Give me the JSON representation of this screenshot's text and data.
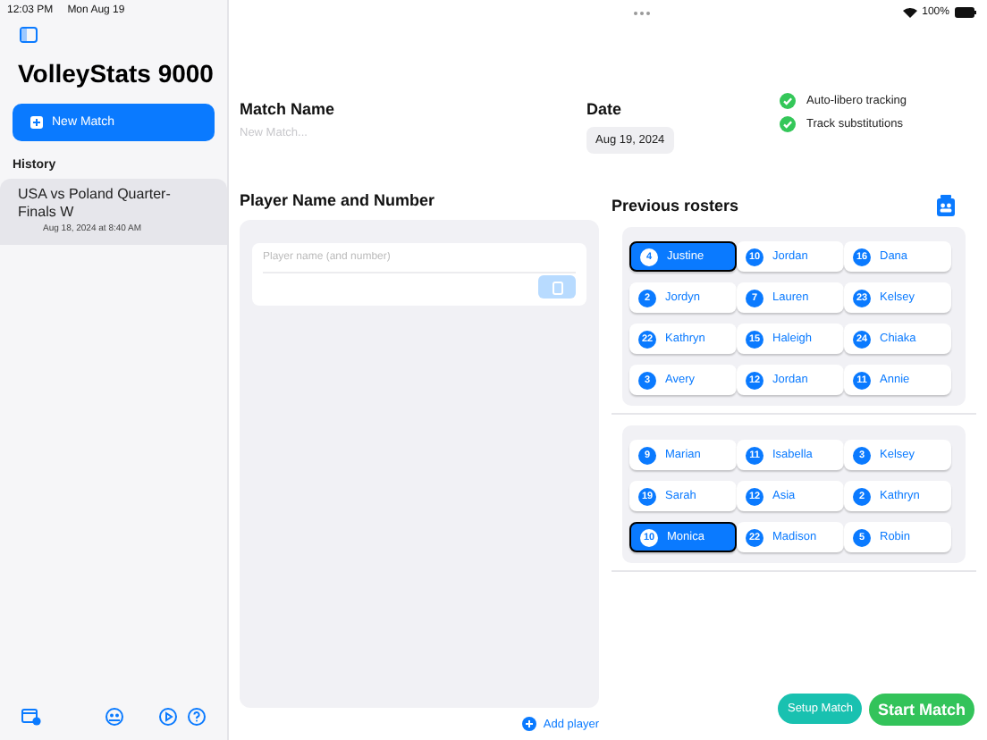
{
  "status_bar": {
    "time": "12:03 PM",
    "date": "Mon Aug 19",
    "battery": "100%"
  },
  "sidebar": {
    "title": "VolleyStats 9000",
    "new_match_button": "New Match",
    "history_label": "History",
    "history": [
      {
        "title": "USA vs Poland Quarter-Finals W",
        "subtitle": "Aug 18, 2024 at 8:40 AM",
        "selected": true
      }
    ]
  },
  "match_name": {
    "label": "Match Name",
    "placeholder": "New Match..."
  },
  "date": {
    "label": "Date",
    "value": "Aug 19, 2024"
  },
  "options": [
    {
      "label": "Auto-libero tracking",
      "checked": true
    },
    {
      "label": "Track substitutions",
      "checked": true
    }
  ],
  "player_entry": {
    "label": "Player Name and Number",
    "placeholder": "Player name (and number)",
    "add_player": "Add player"
  },
  "previous_rosters": {
    "label": "Previous rosters",
    "rosters": [
      {
        "players": [
          {
            "number": "4",
            "name": "Justine",
            "selected": true
          },
          {
            "number": "10",
            "name": "Jordan",
            "selected": false
          },
          {
            "number": "16",
            "name": "Dana",
            "selected": false
          },
          {
            "number": "2",
            "name": "Jordyn",
            "selected": false
          },
          {
            "number": "7",
            "name": "Lauren",
            "selected": false
          },
          {
            "number": "23",
            "name": "Kelsey",
            "selected": false
          },
          {
            "number": "22",
            "name": "Kathryn",
            "selected": false
          },
          {
            "number": "15",
            "name": "Haleigh",
            "selected": false
          },
          {
            "number": "24",
            "name": "Chiaka",
            "selected": false
          },
          {
            "number": "3",
            "name": "Avery",
            "selected": false
          },
          {
            "number": "12",
            "name": "Jordan",
            "selected": false
          },
          {
            "number": "11",
            "name": "Annie",
            "selected": false
          }
        ]
      },
      {
        "players": [
          {
            "number": "9",
            "name": "Marian",
            "selected": false
          },
          {
            "number": "11",
            "name": "Isabella",
            "selected": false
          },
          {
            "number": "3",
            "name": "Kelsey",
            "selected": false
          },
          {
            "number": "19",
            "name": "Sarah",
            "selected": false
          },
          {
            "number": "12",
            "name": "Asia",
            "selected": false
          },
          {
            "number": "2",
            "name": "Kathryn",
            "selected": false
          },
          {
            "number": "10",
            "name": "Monica",
            "selected": true
          },
          {
            "number": "22",
            "name": "Madison",
            "selected": false
          },
          {
            "number": "5",
            "name": "Robin",
            "selected": false
          }
        ]
      }
    ]
  },
  "buttons": {
    "setup": "Setup Match",
    "start": "Start Match"
  }
}
